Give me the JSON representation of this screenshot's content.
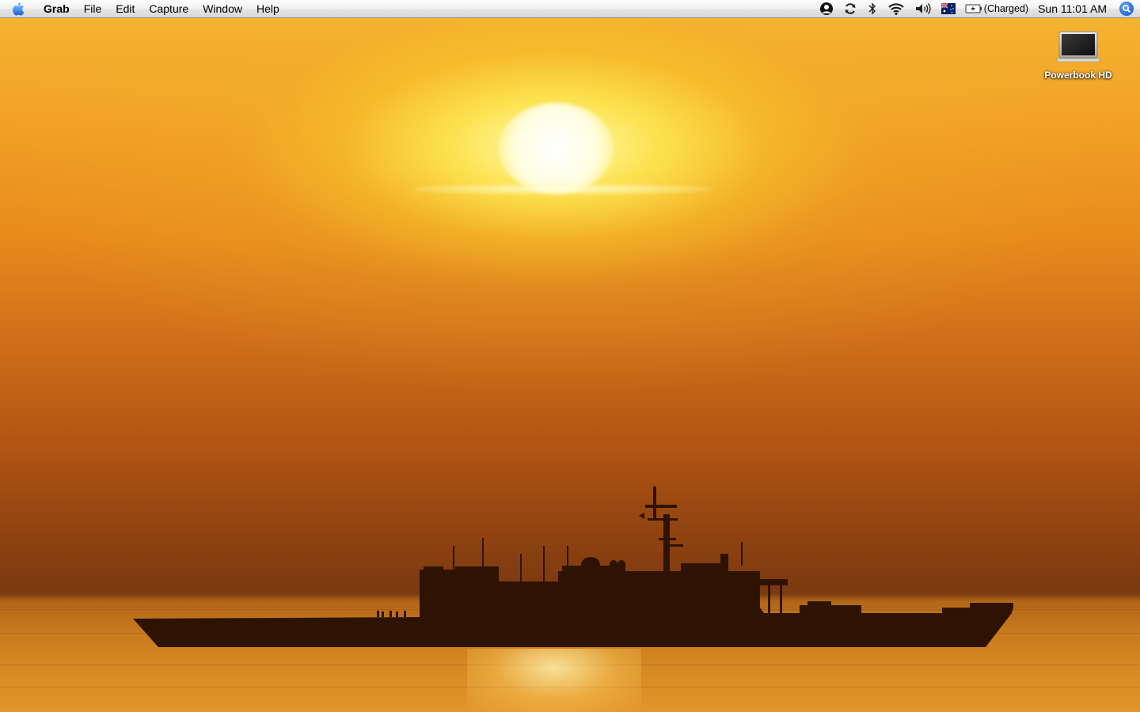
{
  "menubar": {
    "app_name": "Grab",
    "menus": [
      "File",
      "Edit",
      "Capture",
      "Window",
      "Help"
    ],
    "status": {
      "battery_text": "(Charged)",
      "clock": "Sun 11:01 AM"
    },
    "icons": [
      "apple-icon",
      "user-icon",
      "sync-icon",
      "bluetooth-icon",
      "wifi-icon",
      "volume-icon",
      "australia-flag-icon",
      "battery-icon",
      "spotlight-icon"
    ]
  },
  "desktop": {
    "icons": [
      {
        "label": "Powerbook HD",
        "icon": "laptop-drive-icon"
      }
    ],
    "wallpaper": "ship-at-sunset"
  },
  "colors": {
    "spotlight": "#2f6fd8",
    "sky_top": "#f5b631",
    "sky_mid": "#d2701a",
    "horizon": "#7a390f",
    "sun": "#ffffff"
  }
}
